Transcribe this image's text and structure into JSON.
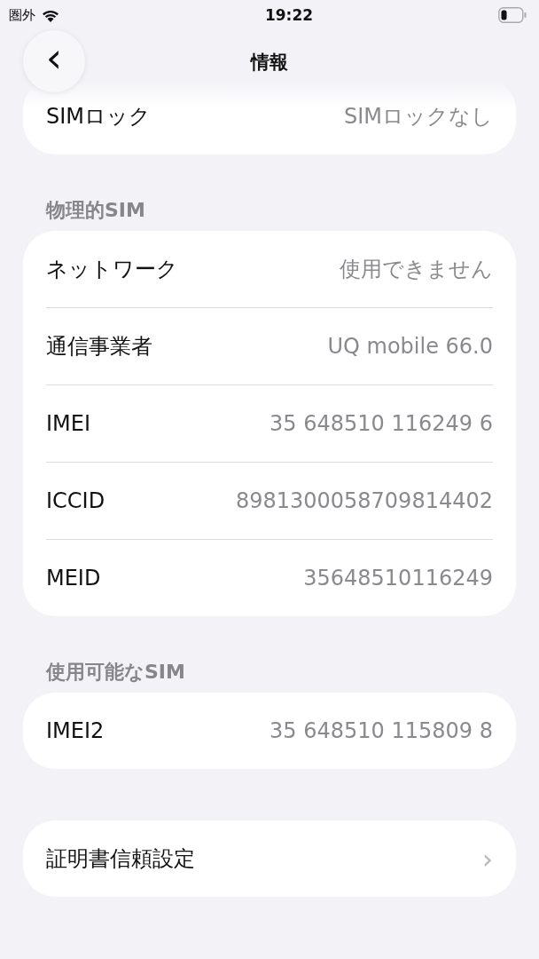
{
  "status_bar": {
    "carrier": "圏外",
    "time": "19:22"
  },
  "nav": {
    "back": "‹",
    "title": "情報"
  },
  "top_group": {
    "rows": [
      {
        "label": "SIMロック",
        "value": "SIMロックなし"
      }
    ]
  },
  "sections": [
    {
      "header": "物理的SIM",
      "rows": [
        {
          "label": "ネットワーク",
          "value": "使用できません"
        },
        {
          "label": "通信事業者",
          "value": "UQ mobile 66.0"
        },
        {
          "label": "IMEI",
          "value": "35 648510 116249 6"
        },
        {
          "label": "ICCID",
          "value": "8981300058709814402"
        },
        {
          "label": "MEID",
          "value": "35648510116249"
        }
      ]
    },
    {
      "header": "使用可能なSIM",
      "rows": [
        {
          "label": "IMEI2",
          "value": "35 648510 115809 8"
        }
      ]
    }
  ],
  "link_row": {
    "label": "証明書信頼設定",
    "chevron": "›"
  }
}
